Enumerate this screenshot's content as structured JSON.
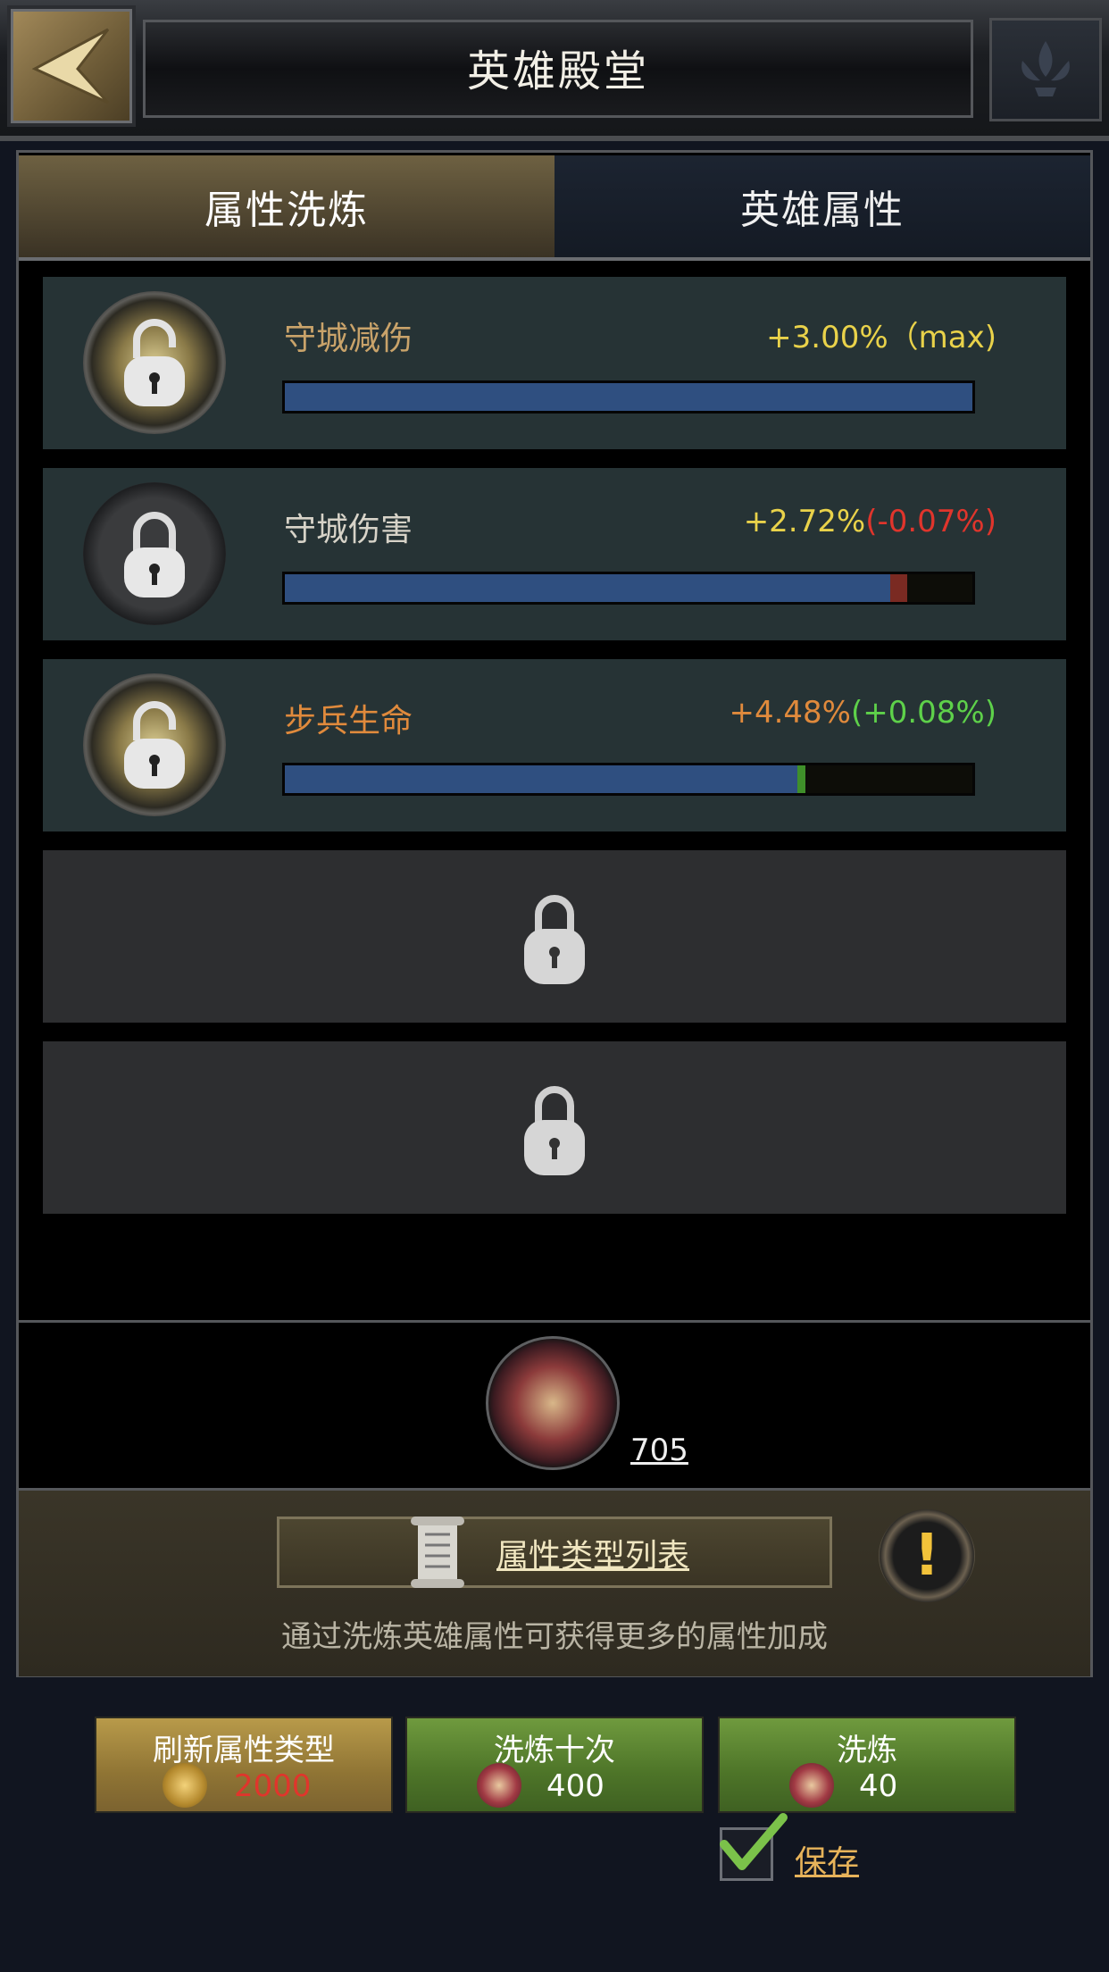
{
  "header": {
    "title": "英雄殿堂"
  },
  "tabs": [
    {
      "label": "属性洗炼",
      "active": true
    },
    {
      "label": "英雄属性",
      "active": false
    }
  ],
  "attributes": [
    {
      "name": "守城减伤",
      "value": "+3.00%",
      "delta": "（max)",
      "name_color": "#c9a36a",
      "value_color": "#e9d24a",
      "delta_color": "#e9d24a",
      "level": 1.0,
      "delta_fraction": 0.0,
      "delta_type": "none",
      "unlocked": true
    },
    {
      "name": "守城伤害",
      "value": "+2.72%",
      "delta": "(-0.07%)",
      "name_color": "#d7d3c8",
      "value_color": "#e9d24a",
      "delta_color": "#e0352c",
      "level": 0.88,
      "delta_fraction": 0.025,
      "delta_type": "negative",
      "unlocked": false
    },
    {
      "name": "步兵生命",
      "value": "+4.48%",
      "delta": "(+0.08%)",
      "name_color": "#e08a3c",
      "value_color": "#e08a3c",
      "delta_color": "#5ed14a",
      "level": 0.745,
      "delta_fraction": 0.012,
      "delta_type": "positive",
      "unlocked": true
    }
  ],
  "locked_slots": 2,
  "hero": {
    "count": "705"
  },
  "info": {
    "type_list_label": "属性类型列表",
    "hint": "通过洗炼英雄属性可获得更多的属性加成"
  },
  "actions": {
    "refresh": {
      "label": "刷新属性类型",
      "cost": "2000",
      "cost_color": "#e0352c",
      "icon": "gold-coin-icon"
    },
    "refine_ten": {
      "label": "洗炼十次",
      "cost": "400",
      "cost_color": "#ffffff",
      "icon": "hero-token-icon"
    },
    "refine_once": {
      "label": "洗炼",
      "cost": "40",
      "cost_color": "#ffffff",
      "icon": "hero-token-icon"
    }
  },
  "save": {
    "label": "保存",
    "checked": true
  }
}
